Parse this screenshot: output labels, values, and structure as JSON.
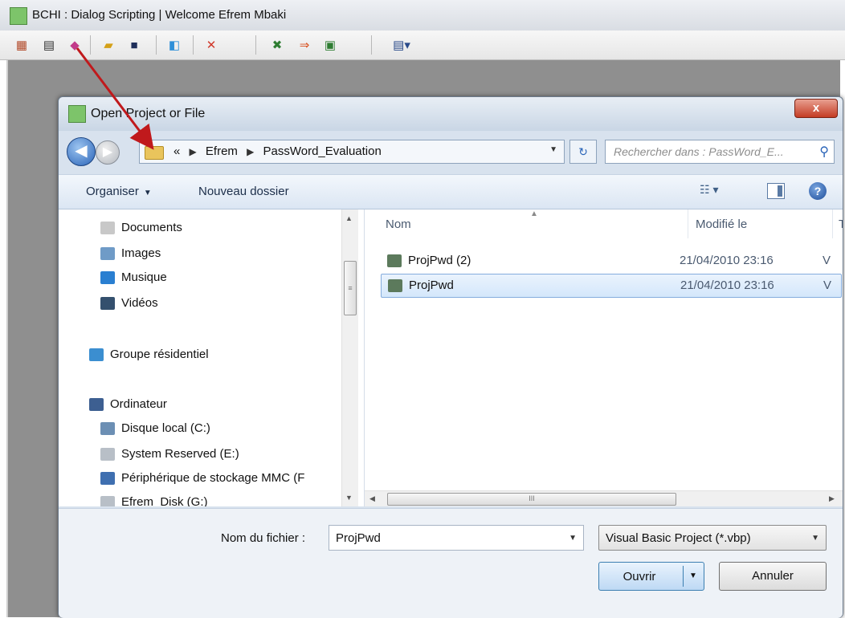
{
  "app": {
    "title": "BCHI : Dialog Scripting  | Welcome  Efrem Mbaki",
    "toolbar": [
      {
        "name": "new-form-icon",
        "glyph": "▦",
        "color": "#b24a2a"
      },
      {
        "name": "properties-icon",
        "glyph": "▤",
        "color": "#333333"
      },
      {
        "name": "open-project-icon",
        "glyph": "◆",
        "color": "#c23b8a"
      },
      {
        "name": "open-folder-icon",
        "glyph": "▰",
        "color": "#d4a017"
      },
      {
        "name": "save-icon",
        "glyph": "■",
        "color": "#1f2f5a"
      },
      {
        "name": "exit-icon",
        "glyph": "◧",
        "color": "#2f8fd8"
      },
      {
        "name": "delete-icon",
        "glyph": "✕",
        "color": "#d0392b"
      },
      {
        "name": "tools-icon",
        "glyph": "✖",
        "color": "#2e7d32"
      },
      {
        "name": "forward-arrow-icon",
        "glyph": "⇒",
        "color": "#d8501f"
      },
      {
        "name": "settings-form-icon",
        "glyph": "▣",
        "color": "#2e7d32"
      },
      {
        "name": "layout-dropdown-icon",
        "glyph": "▤▾",
        "color": "#2b4b8a"
      }
    ]
  },
  "dialog": {
    "title": "Open Project or File",
    "close_label": "x",
    "breadcrumb": [
      "«",
      "Efrem",
      "PassWord_Evaluation"
    ],
    "search_placeholder": "Rechercher dans : PassWord_E...",
    "commands": {
      "organize": "Organiser",
      "new_folder": "Nouveau dossier"
    },
    "nav_items": [
      {
        "label": "Documents",
        "icon": "documents-icon",
        "color": "#c8c8c8"
      },
      {
        "label": "Images",
        "icon": "images-icon",
        "color": "#6f9bc7"
      },
      {
        "label": "Musique",
        "icon": "music-icon",
        "color": "#2a7fd1"
      },
      {
        "label": "Vidéos",
        "icon": "videos-icon",
        "color": "#34506e"
      },
      {
        "label": "Groupe résidentiel",
        "icon": "homegroup-icon",
        "color": "#3b8ed0"
      },
      {
        "label": "Ordinateur",
        "icon": "computer-icon",
        "color": "#3d5f91"
      },
      {
        "label": "Disque local (C:)",
        "icon": "local-disk-icon",
        "color": "#6c8fb4"
      },
      {
        "label": "System Reserved (E:)",
        "icon": "drive-icon",
        "color": "#b8bfc7"
      },
      {
        "label": "Périphérique de stockage MMC (F",
        "icon": "usb-storage-icon",
        "color": "#3f6fb0"
      },
      {
        "label": "Efrem_Disk (G:)",
        "icon": "drive-icon",
        "color": "#b8bfc7"
      }
    ],
    "columns": {
      "name": "Nom",
      "modified": "Modifié le",
      "type": "T"
    },
    "files": [
      {
        "name": "ProjPwd (2)",
        "modified": "21/04/2010 23:16",
        "type": "V",
        "selected": false
      },
      {
        "name": "ProjPwd",
        "modified": "21/04/2010 23:16",
        "type": "V",
        "selected": true
      }
    ],
    "filename_label": "Nom du fichier :",
    "filename_value": "ProjPwd",
    "filetype": "Visual Basic Project (*.vbp)",
    "open_label": "Ouvrir",
    "cancel_label": "Annuler",
    "scroll_glyph": "III"
  }
}
